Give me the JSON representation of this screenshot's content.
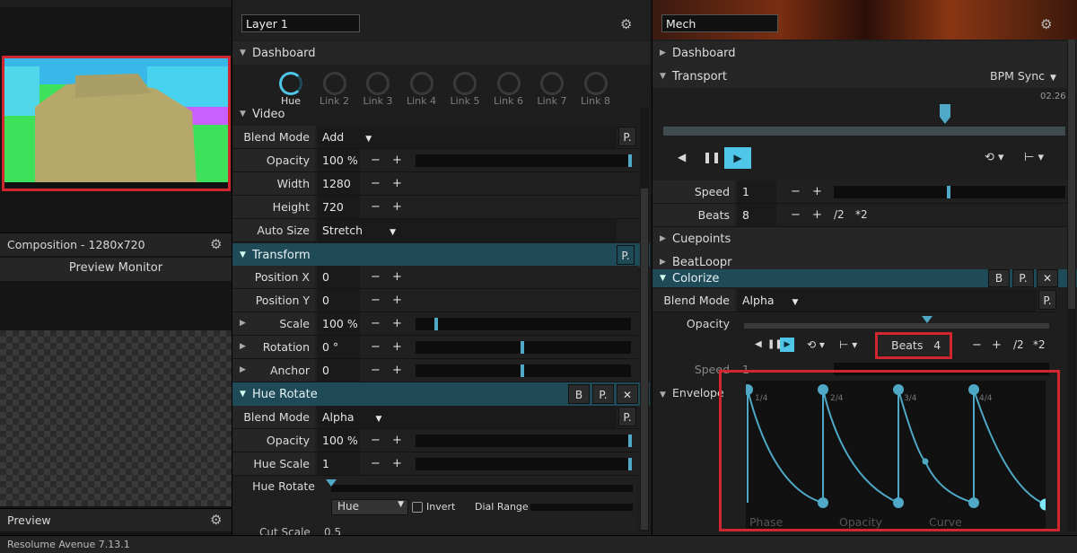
{
  "left": {
    "composition_label": "Composition - 1280x720",
    "preview_monitor": "Preview Monitor",
    "preview_label": "Preview"
  },
  "mid": {
    "layer_name": "Layer 1",
    "dashboard": "Dashboard",
    "knobs": [
      "Hue",
      "Link 2",
      "Link 3",
      "Link 4",
      "Link 5",
      "Link 6",
      "Link 7",
      "Link 8"
    ],
    "video": "Video",
    "video_rows": [
      {
        "label": "Blend Mode",
        "value": "Add",
        "type": "dropdown"
      },
      {
        "label": "Opacity",
        "value": "100 %",
        "type": "slider"
      },
      {
        "label": "Width",
        "value": "1280",
        "type": "pm"
      },
      {
        "label": "Height",
        "value": "720",
        "type": "pm"
      },
      {
        "label": "Auto Size",
        "value": "Stretch",
        "type": "dropdown"
      }
    ],
    "transform": "Transform",
    "transform_rows": [
      {
        "label": "Position X",
        "value": "0"
      },
      {
        "label": "Position Y",
        "value": "0"
      },
      {
        "label": "Scale",
        "value": "100 %"
      },
      {
        "label": "Rotation",
        "value": "0 °"
      },
      {
        "label": "Anchor",
        "value": "0"
      }
    ],
    "hue_rotate": "Hue Rotate",
    "hue_rows": [
      {
        "label": "Blend Mode",
        "value": "Alpha"
      },
      {
        "label": "Opacity",
        "value": "100 %"
      },
      {
        "label": "Hue Scale",
        "value": "1"
      },
      {
        "label": "Hue Rotate",
        "value": ""
      }
    ],
    "hue_select": "Hue",
    "invert": "Invert",
    "dial_range": "Dial Range",
    "cut_scale": "Cut Scale",
    "cut_value": "0.5"
  },
  "right": {
    "clip_name": "Mech",
    "dashboard": "Dashboard",
    "transport": "Transport",
    "bpm_sync": "BPM Sync",
    "time": "02.26",
    "speed_label": "Speed",
    "speed_value": "1",
    "beats_label": "Beats",
    "beats_value": "8",
    "div2": "/2",
    "mul2": "*2",
    "cuepoints": "Cuepoints",
    "beatloopr": "BeatLoopr",
    "colorize": "Colorize",
    "blend_mode_label": "Blend Mode",
    "blend_mode_value": "Alpha",
    "opacity_label": "Opacity",
    "beats2_label": "Beats",
    "beats2_value": "4",
    "speed2_label": "Speed",
    "speed2_value": "1",
    "envelope": "Envelope",
    "env_marks": [
      "1/4",
      "2/4",
      "3/4",
      "4/4"
    ],
    "env_footer": [
      "Phase",
      "Opacity",
      "Curve"
    ]
  },
  "buttons": {
    "b": "B",
    "p": "P.",
    "x": "✕"
  },
  "plusminus": {
    "minus": "−",
    "plus": "+"
  },
  "status": "Resolume Avenue 7.13.1",
  "colors": {
    "teal": "#1f4a57",
    "accent": "#4fc6e8",
    "highlight": "#d0262f"
  }
}
